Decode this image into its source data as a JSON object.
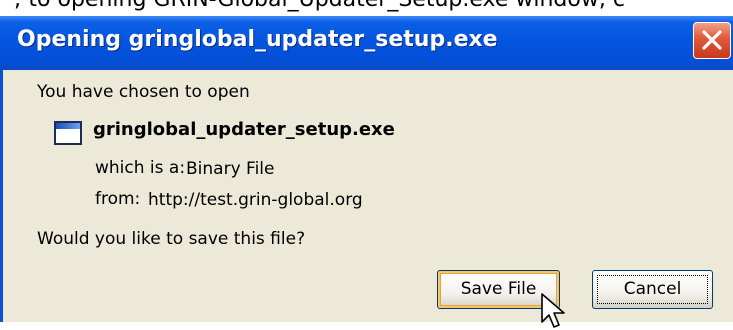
{
  "background_text": "; to opening GRIN-Global_Updater_Setup.exe window, c",
  "dialog": {
    "title": "Opening gringlobal_updater_setup.exe",
    "intro": "You have chosen to open",
    "file_name": "gringlobal_updater_setup.exe",
    "which_is_label": "which is a:",
    "which_is_value": "Binary File",
    "from_label": "from:",
    "from_value": "http://test.grin-global.org",
    "question": "Would you like to save this file?"
  },
  "buttons": {
    "save": "Save File",
    "cancel": "Cancel"
  },
  "icons": {
    "close": "close-icon",
    "file": "application-window-icon",
    "cursor": "mouse-pointer-icon"
  },
  "colors": {
    "titlebar": "#0454dd",
    "client": "#ece9d8",
    "close": "#e0583a",
    "default_button_highlight": "#f6c76a"
  }
}
